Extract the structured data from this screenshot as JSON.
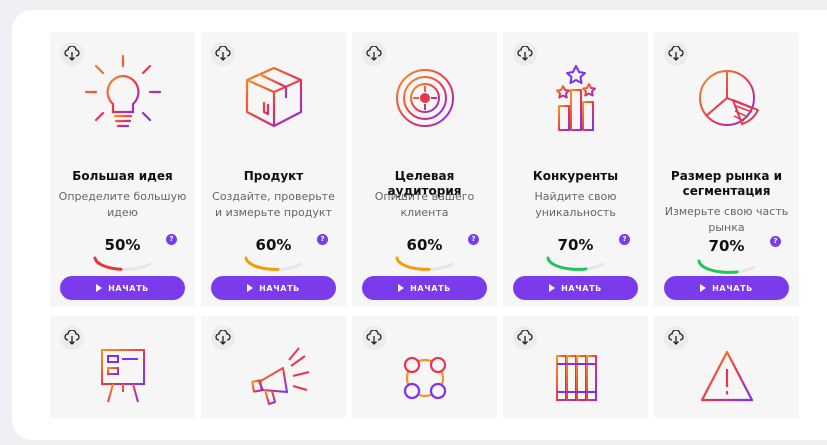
{
  "accent": "#7c3aed",
  "cards": [
    {
      "title": "Большая идея",
      "desc": "Определите большую идею",
      "percent": "50%",
      "progress": 0.5,
      "progress_color": "#e53935",
      "button": "НАЧАТЬ",
      "icon": "lightbulb-icon"
    },
    {
      "title": "Продукт",
      "desc": "Создайте, проверьте и измерьте продукт",
      "percent": "60%",
      "progress": 0.6,
      "progress_color": "#f59e0b",
      "button": "НАЧАТЬ",
      "icon": "box-icon"
    },
    {
      "title": "Целевая аудитория",
      "desc": "Опишите вашего клиента",
      "percent": "60%",
      "progress": 0.6,
      "progress_color": "#f59e0b",
      "button": "НАЧАТЬ",
      "icon": "target-icon"
    },
    {
      "title": "Конкуренты",
      "desc": "Найдите свою уникальность",
      "percent": "70%",
      "progress": 0.7,
      "progress_color": "#22c55e",
      "button": "НАЧАТЬ",
      "icon": "podium-stars-icon"
    },
    {
      "title": "Размер рынка и сегментация",
      "desc": "Измерьте свою часть рынка",
      "percent": "70%",
      "progress": 0.7,
      "progress_color": "#22c55e",
      "button": "НАЧАТЬ",
      "icon": "pie-chart-icon"
    }
  ],
  "cards_row2": [
    {
      "icon": "presentation-board-icon"
    },
    {
      "icon": "megaphone-icon"
    },
    {
      "icon": "network-circles-icon"
    },
    {
      "icon": "binders-icon"
    },
    {
      "icon": "warning-triangle-icon"
    }
  ]
}
